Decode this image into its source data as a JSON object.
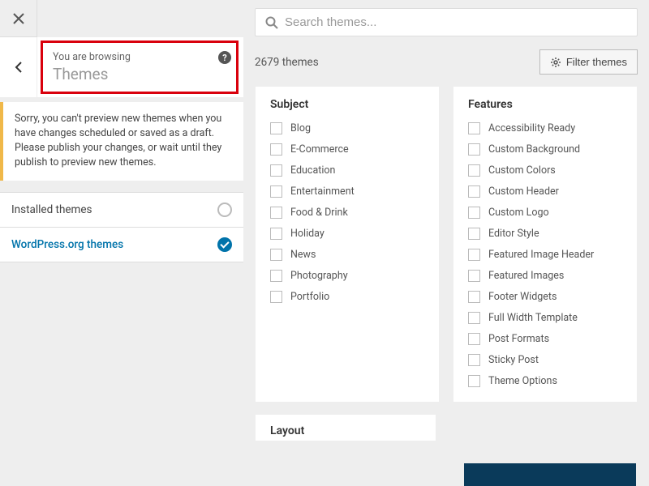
{
  "sidebar": {
    "browsing_label": "You are browsing",
    "browsing_title": "Themes",
    "notice": "Sorry, you can't preview new themes when you have changes scheduled or saved as a draft. Please publish your changes, or wait until they publish to preview new themes.",
    "sources": [
      {
        "label": "Installed themes",
        "selected": false
      },
      {
        "label": "WordPress.org themes",
        "selected": true
      }
    ]
  },
  "search": {
    "placeholder": "Search themes..."
  },
  "count_text": "2679 themes",
  "filter_button": "Filter themes",
  "filter_groups": {
    "subject": {
      "title": "Subject",
      "items": [
        "Blog",
        "E-Commerce",
        "Education",
        "Entertainment",
        "Food & Drink",
        "Holiday",
        "News",
        "Photography",
        "Portfolio"
      ]
    },
    "features": {
      "title": "Features",
      "items": [
        "Accessibility Ready",
        "Custom Background",
        "Custom Colors",
        "Custom Header",
        "Custom Logo",
        "Editor Style",
        "Featured Image Header",
        "Featured Images",
        "Footer Widgets",
        "Full Width Template",
        "Post Formats",
        "Sticky Post",
        "Theme Options"
      ]
    },
    "layout": {
      "title": "Layout"
    }
  }
}
